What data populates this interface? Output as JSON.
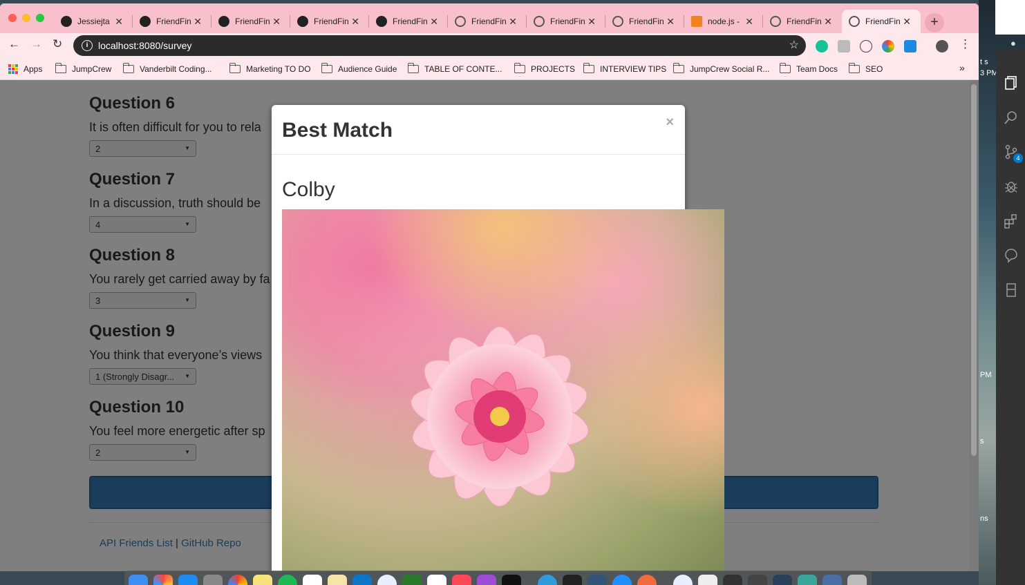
{
  "browser": {
    "tabs": [
      {
        "label": "Jessiejta",
        "icon": "github-icon"
      },
      {
        "label": "FriendFin",
        "icon": "github-icon"
      },
      {
        "label": "FriendFin",
        "icon": "github-icon"
      },
      {
        "label": "FriendFin",
        "icon": "github-icon"
      },
      {
        "label": "FriendFin",
        "icon": "github-icon"
      },
      {
        "label": "FriendFin",
        "icon": "globe-icon"
      },
      {
        "label": "FriendFin",
        "icon": "globe-icon"
      },
      {
        "label": "FriendFin",
        "icon": "globe-icon"
      },
      {
        "label": "node.js -",
        "icon": "stackoverflow-icon"
      },
      {
        "label": "FriendFin",
        "icon": "globe-icon"
      },
      {
        "label": "FriendFin",
        "icon": "globe-icon",
        "active": true
      }
    ],
    "url": "localhost:8080/survey",
    "bookmarks": [
      {
        "label": "Apps",
        "icon": "apps-grid-icon"
      },
      {
        "label": "JumpCrew",
        "icon": "page-icon"
      },
      {
        "label": "Vanderbilt Coding...",
        "icon": "folder-icon"
      },
      {
        "label": "Marketing TO DO",
        "icon": "folder-icon"
      },
      {
        "label": "Audience Guide",
        "icon": "folder-icon"
      },
      {
        "label": "TABLE OF CONTE...",
        "icon": "folder-icon"
      },
      {
        "label": "PROJECTS",
        "icon": "folder-icon"
      },
      {
        "label": "INTERVIEW TIPS",
        "icon": "folder-icon"
      },
      {
        "label": "JumpCrew Social R...",
        "icon": "folder-icon"
      },
      {
        "label": "Team Docs",
        "icon": "folder-icon"
      },
      {
        "label": "SEO",
        "icon": "folder-icon"
      }
    ],
    "bookmarks_overflow": "»",
    "new_tab": "+"
  },
  "survey": {
    "questions": [
      {
        "title": "Question 6",
        "text": "It is often difficult for you to rela",
        "answer": "2"
      },
      {
        "title": "Question 7",
        "text": "In a discussion, truth should be",
        "answer": "4"
      },
      {
        "title": "Question 8",
        "text": "You rarely get carried away by fa",
        "answer": "3"
      },
      {
        "title": "Question 9",
        "text": "You think that everyone’s views",
        "answer": "1 (Strongly Disagr..."
      },
      {
        "title": "Question 10",
        "text": "You feel more energetic after sp",
        "answer": "2"
      }
    ],
    "footer": {
      "api_link": "API Friends List",
      "separator": "|",
      "repo_link": "GitHub Repo"
    }
  },
  "modal": {
    "title": "Best Match",
    "close": "×",
    "match_name": "Colby",
    "photo": "pink-dahlia-flower"
  },
  "desktop": {
    "fragments": [
      "t s",
      "3 PM",
      "PM",
      "s",
      "ns"
    ],
    "vscode_badge": "4"
  },
  "colors": {
    "tab_bar": "#f8c0cb",
    "toolbar": "#fde8ec",
    "primary_button": "#337ab7",
    "link": "#337ab7"
  }
}
